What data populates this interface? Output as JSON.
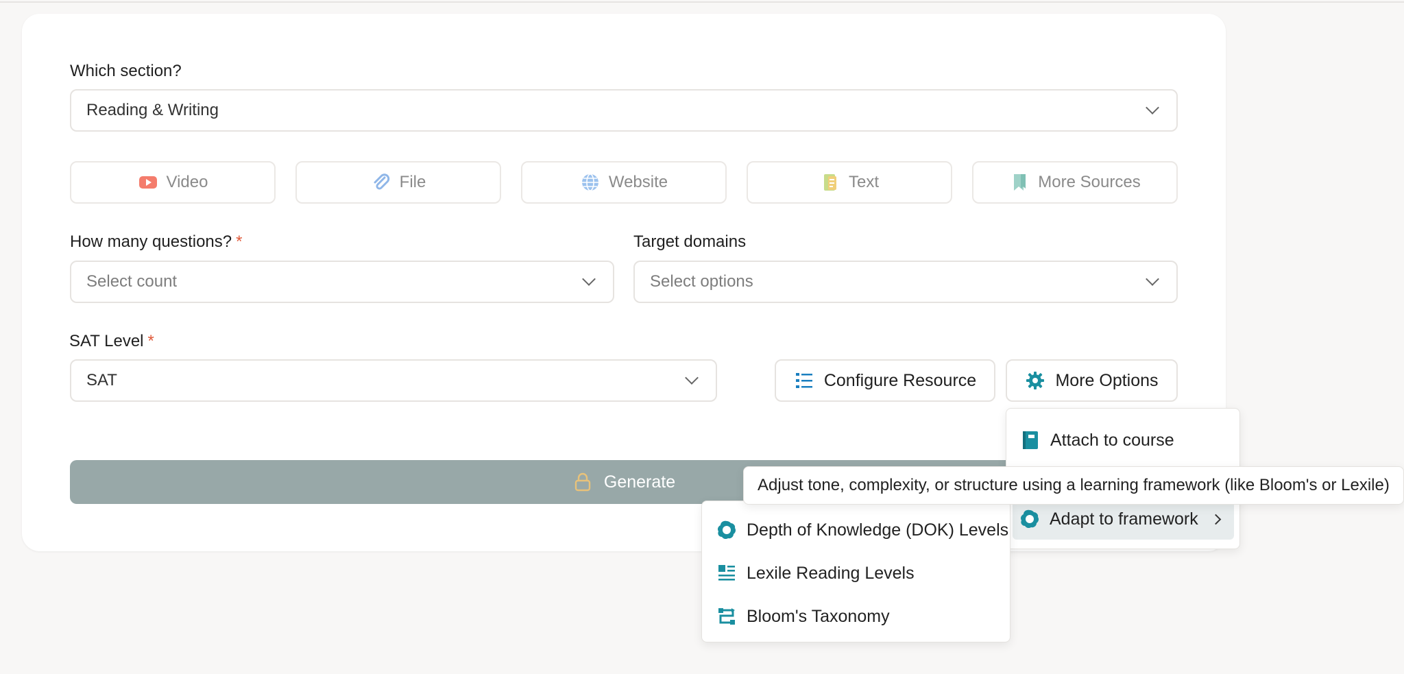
{
  "form": {
    "section": {
      "label": "Which section?",
      "value": "Reading & Writing"
    },
    "sources": [
      {
        "label": "Video",
        "icon": "youtube-icon"
      },
      {
        "label": "File",
        "icon": "paperclip-icon"
      },
      {
        "label": "Website",
        "icon": "globe-icon"
      },
      {
        "label": "Text",
        "icon": "text-doc-icon"
      },
      {
        "label": "More Sources",
        "icon": "bookmark-icon"
      }
    ],
    "questions": {
      "label": "How many questions?",
      "required_mark": "*",
      "placeholder": "Select count"
    },
    "domains": {
      "label": "Target domains",
      "placeholder": "Select options"
    },
    "sat_level": {
      "label": "SAT Level",
      "required_mark": "*",
      "value": "SAT"
    },
    "configure_label": "Configure Resource",
    "more_options_label": "More Options",
    "generate_label": "Generate"
  },
  "more_options_menu": {
    "items": [
      {
        "label": "Attach to course",
        "icon": "notebook-icon"
      },
      {
        "label": "Adapt to framework",
        "icon": "framework-icon",
        "highlighted": true
      }
    ]
  },
  "tooltip": "Adjust tone, complexity, or structure using a learning framework (like Bloom's or Lexile)",
  "framework_submenu": {
    "items": [
      {
        "label": "Depth of Knowledge (DOK) Levels",
        "icon": "dok-icon"
      },
      {
        "label": "Lexile Reading Levels",
        "icon": "lexile-icon"
      },
      {
        "label": "Bloom's Taxonomy",
        "icon": "bloom-icon"
      }
    ]
  },
  "colors": {
    "accent_teal": "#1a8fa0",
    "generate_bg": "#98a8a8",
    "required": "#e05a3a",
    "lock": "#e8c27a"
  }
}
